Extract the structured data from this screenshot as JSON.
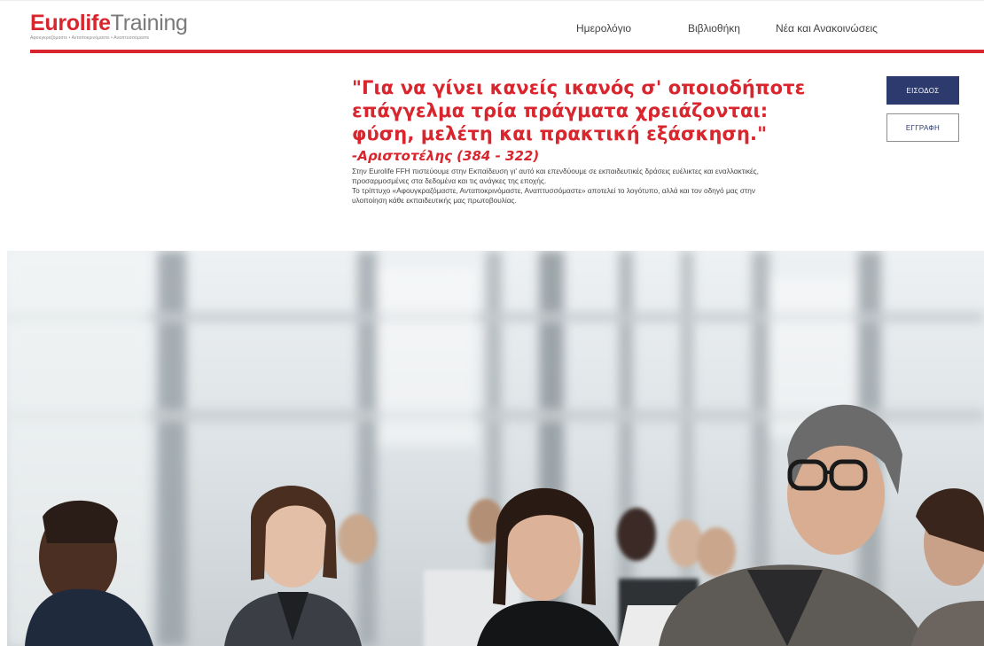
{
  "brand": {
    "name_red": "Eurolife",
    "name_grey": "Training",
    "tagline": "Αφουγκραζόμαστε • Ανταποκρινόμαστε • Αναπτυσσόμαστε"
  },
  "nav": {
    "items": [
      {
        "label": "Ημερολόγιο"
      },
      {
        "label": "Βιβλιοθήκη"
      },
      {
        "label": "Νέα και Ανακοινώσεις"
      }
    ]
  },
  "auth": {
    "login_label": "ΕΙΣΟΔΟΣ",
    "register_label": "ΕΓΓΡΑΦΗ"
  },
  "quote": {
    "text": "\"Για να γίνει κανείς ικανός σ' οποιοδήποτε επάγγελμα τρία πράγματα χρειάζονται: φύση, μελέτη και πρακτική εξάσκηση.\"",
    "author": "-Αριστοτέλης (384 - 322)",
    "body_line1": "Στην Eurolife FFH πιστεύουμε στην Εκπαίδευση γι' αυτό και επενδύουμε σε εκπαιδευτικές δράσεις ευέλικτες και εναλλακτικές, προσαρμοσμένες στα δεδομένα και τις ανάγκες της εποχής.",
    "body_line2": "Το τρίπτυχο «Αφουγκραζόμαστε, Ανταποκρινόμαστε, Αναπτυσσόμαστε» αποτελεί το λογότυπο, αλλά και τον οδηγό μας στην υλοποίηση κάθε εκπαιδευτικής μας πρωτοβουλίας."
  },
  "colors": {
    "brand_red": "#d9252d",
    "button_navy": "#2d3a6d"
  }
}
